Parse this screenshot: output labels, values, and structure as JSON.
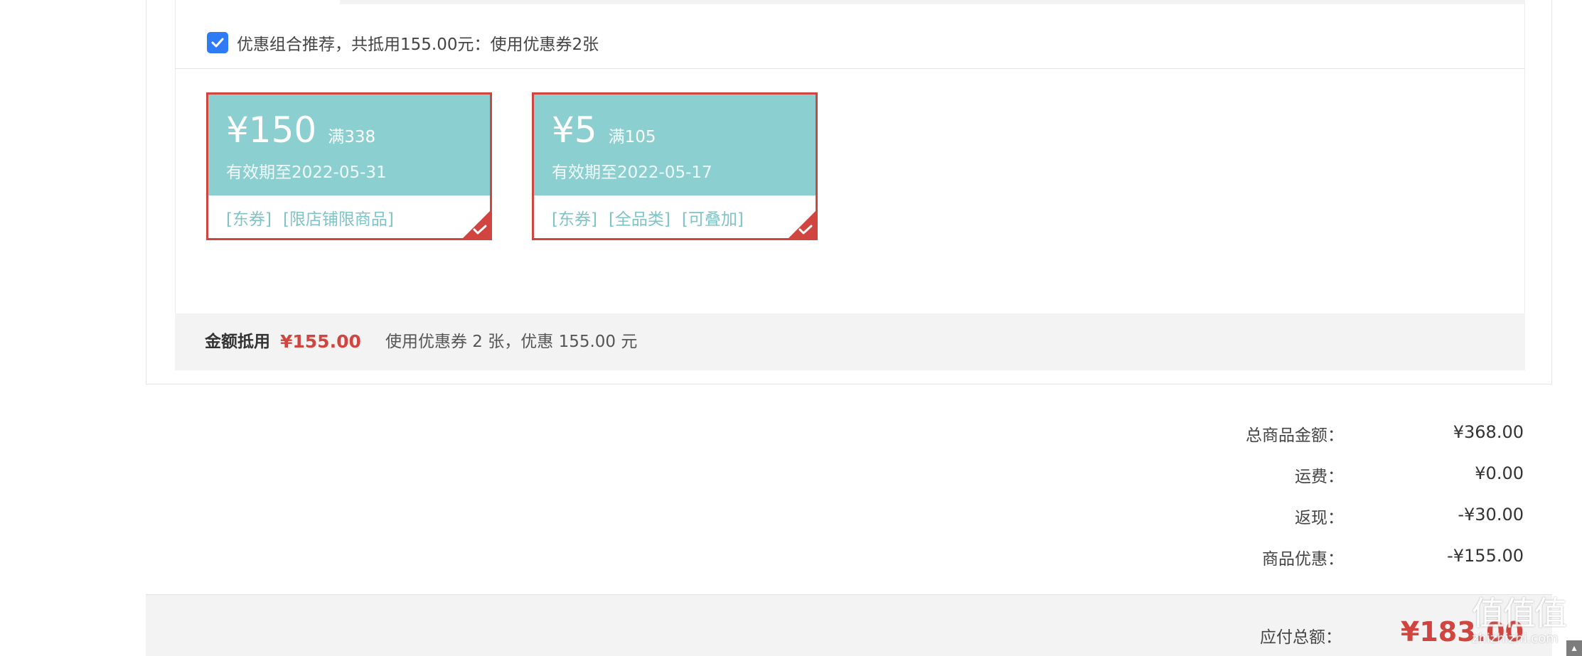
{
  "coupon_section": {
    "combo_checked": true,
    "combo_text": "优惠组合推荐，共抵用155.00元：使用优惠券2张",
    "coupons": [
      {
        "value": "¥150",
        "threshold": "满338",
        "validity": "有效期至2022-05-31",
        "tags": [
          "[东券]",
          "[限店铺限商品]"
        ],
        "selected": true
      },
      {
        "value": "¥5",
        "threshold": "满105",
        "validity": "有效期至2022-05-17",
        "tags": [
          "[东券]",
          "[全品类]",
          "[可叠加]"
        ],
        "selected": true
      }
    ],
    "summary": {
      "label": "金额抵用",
      "amount": "¥155.00",
      "description": "使用优惠券 2 张，优惠 155.00 元"
    }
  },
  "totals": [
    {
      "label": "总商品金额：",
      "value": "¥368.00"
    },
    {
      "label": "运费：",
      "value": "¥0.00"
    },
    {
      "label": "返现：",
      "value": "-¥30.00"
    },
    {
      "label": "商品优惠：",
      "value": "-¥155.00"
    }
  ],
  "payable": {
    "label": "应付总额：",
    "value": "¥183.00"
  },
  "watermark": {
    "logo": "值值值",
    "url": "zhizhizhi.com"
  },
  "colors": {
    "accent_red": "#d0453f",
    "coupon_teal": "#8ccfd1",
    "tag_teal": "#7fc3c6",
    "checkbox_blue": "#2f7bf5"
  },
  "icons": {
    "checkbox": "checkmark-icon",
    "coupon_selected": "checkmark-icon"
  }
}
